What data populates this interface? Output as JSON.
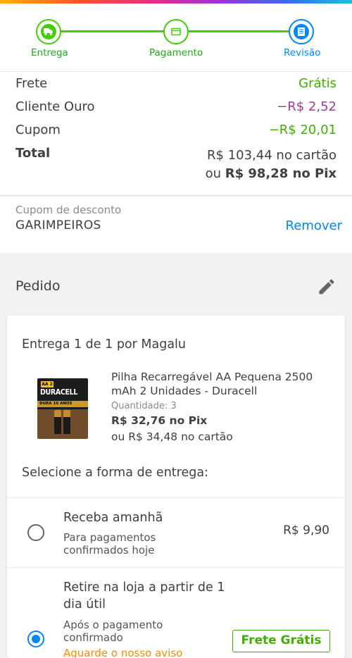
{
  "stepper": {
    "steps": [
      {
        "label": "Entrega",
        "icon": "truck-icon",
        "state": "done"
      },
      {
        "label": "Pagamento",
        "icon": "card-icon",
        "state": "done"
      },
      {
        "label": "Revisão",
        "icon": "receipt-icon",
        "state": "current"
      }
    ]
  },
  "summary": {
    "frete_label": "Frete",
    "frete_value": "Grátis",
    "cliente_ouro_label": "Cliente Ouro",
    "cliente_ouro_value": "−R$ 2,52",
    "cupom_label": "Cupom",
    "cupom_value": "−R$ 20,01",
    "total_label": "Total",
    "total_card": "R$ 103,44 no cartão",
    "total_pix_prefix": "ou",
    "total_pix": "R$ 98,28 no Pix"
  },
  "coupon": {
    "label": "Cupom de desconto",
    "code": "GARIMPEIROS",
    "remove_label": "Remover"
  },
  "pedido": {
    "title": "Pedido",
    "edit_icon": "pencil-icon"
  },
  "delivery": {
    "title": "Entrega 1 de 1 por Magalu",
    "product": {
      "name": "Pilha Recarregável AA Pequena 2500 mAh 2 Unidades - Duracell",
      "qty_label": "Quantidade:",
      "qty_value": "3",
      "price_pix": "R$ 32,76 no Pix",
      "price_card": "ou R$ 34,48 no cartão",
      "image_brand": "DURACELL",
      "image_size": "AA 2",
      "image_band": "DURA 10 ANOS"
    },
    "select_title": "Selecione a forma de entrega:",
    "options": [
      {
        "title": "Receba amanhã",
        "subtitle": "Para pagamentos confirmados hoje",
        "price": "R$ 9,90",
        "selected": false
      },
      {
        "title": "Retire na loja a partir de 1 dia útil",
        "subtitle": "Após o pagamento confirmado",
        "warning": "Aguarde o nosso aviso",
        "badge": "Frete Grátis",
        "selected": true
      }
    ]
  },
  "colors": {
    "green": "#3fd000",
    "blue": "#0086ff",
    "purple": "#a13b9c",
    "orange": "#ff8a00"
  }
}
